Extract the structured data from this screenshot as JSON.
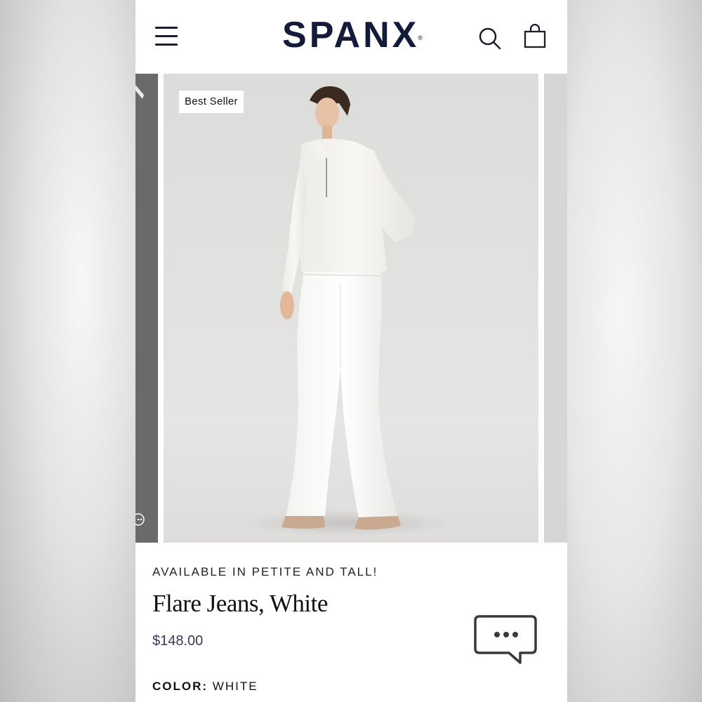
{
  "header": {
    "logo": "SPANX",
    "logo_mark": "®",
    "icons": [
      "hamburger-menu-icon",
      "search-icon",
      "shopping-bag-icon"
    ]
  },
  "carousel": {
    "badge": "Best Seller"
  },
  "product": {
    "availability": "AVAILABLE IN PETITE AND TALL!",
    "title": "Flare Jeans, White",
    "price": "$148.00",
    "color_label": "COLOR:",
    "color_value": "WHITE"
  },
  "chat": {
    "icon": "chat-bubble-icon"
  },
  "colors": {
    "brand_navy": "#141a3a",
    "price_text": "#3a3a5c"
  }
}
